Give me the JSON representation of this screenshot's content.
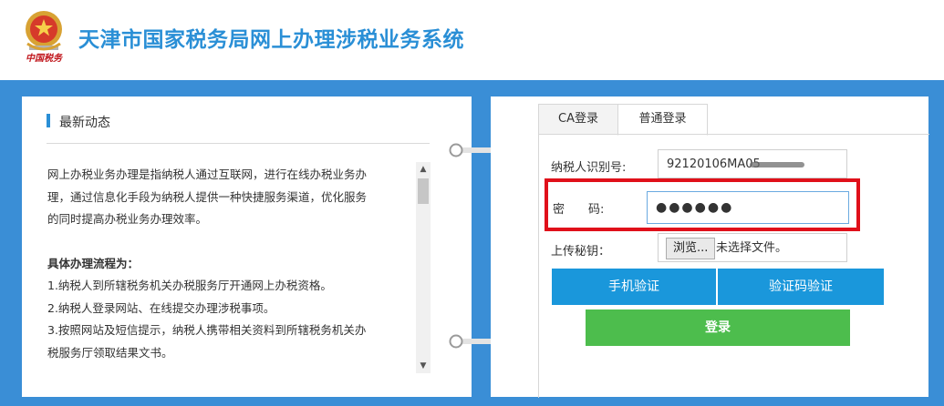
{
  "header": {
    "title": "天津市国家税务局网上办理涉税业务系统",
    "emblem_caption": "中国税务"
  },
  "news": {
    "heading": "最新动态",
    "paragraphs": [
      "网上办税业务办理是指纳税人通过互联网，进行在线办税业务办",
      "理，通过信息化手段为纳税人提供一种快捷服务渠道，优化服务",
      "的同时提高办税业务办理效率。"
    ],
    "process_title": "具体办理流程为：",
    "steps": [
      "1.纳税人到所辖税务机关办税服务厅开通网上办税资格。",
      "2.纳税人登录网站、在线提交办理涉税事项。",
      "3.按照网站及短信提示，纳税人携带相关资料到所辖税务机关办",
      "税服务厅领取结果文书。"
    ]
  },
  "login": {
    "tabs": [
      "CA登录",
      "普通登录"
    ],
    "active_tab": "普通登录",
    "taxid_label": "纳税人识别号:",
    "taxid_value": "92120106MA05",
    "password_label": "密　　码:",
    "password_value": "●●●●●●",
    "upload_label": "上传秘钥：",
    "browse_label": "浏览...",
    "no_file_text": "未选择文件。",
    "phone_verify_label": "手机验证",
    "captcha_verify_label": "验证码验证",
    "login_label": "登录"
  },
  "colors": {
    "brand_blue": "#2a8fd6",
    "band_blue": "#3a8ed6",
    "button_blue": "#1a97db",
    "login_green": "#4dbd4d",
    "highlight_red": "#e0101a"
  }
}
